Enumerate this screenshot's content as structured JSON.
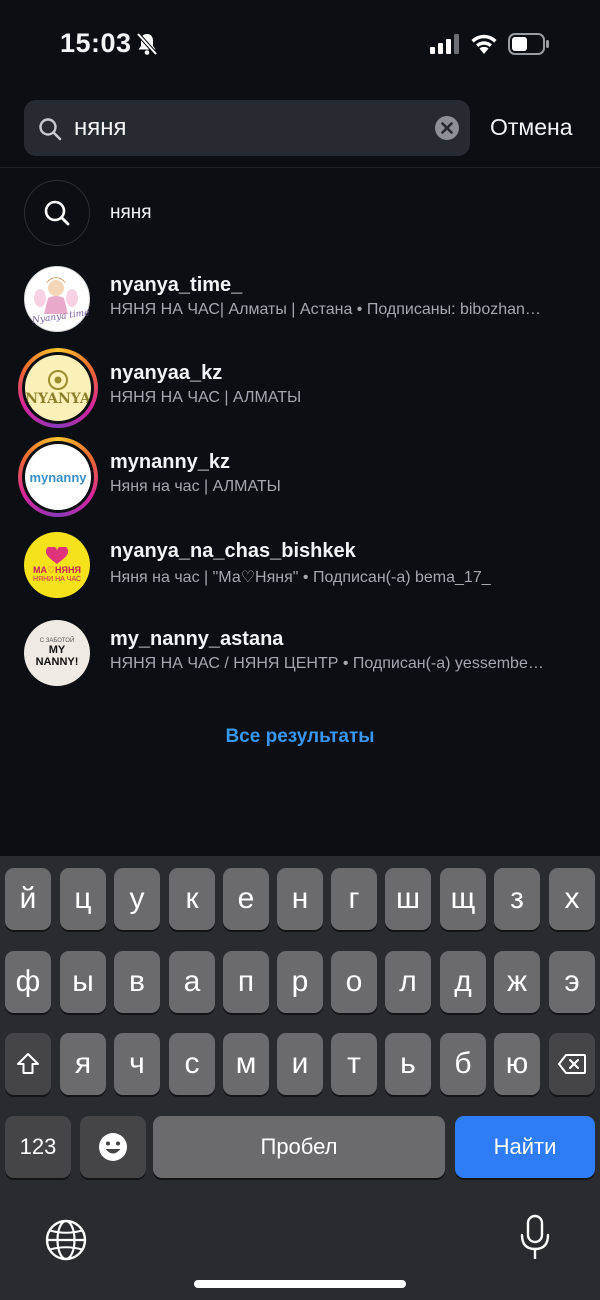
{
  "status_bar": {
    "time": "15:03",
    "icons": [
      "bell-slash-icon",
      "cellular-signal-icon",
      "wifi-icon",
      "battery-icon"
    ]
  },
  "search": {
    "query": "няня",
    "cancel_label": "Отмена"
  },
  "suggestion": {
    "text": "няня"
  },
  "results": [
    {
      "username": "nyanya_time_",
      "subtitle": "НЯНЯ НА ЧАС| Алматы | Астана • Подписаны: bibozhan…",
      "avatar_text": "Nyanya time",
      "has_story": false
    },
    {
      "username": "nyanyaa_kz",
      "subtitle": "НЯНЯ НА ЧАС | АЛМАТЫ",
      "avatar_text": "NYANYA",
      "has_story": true
    },
    {
      "username": "mynanny_kz",
      "subtitle": "Няня на час | АЛМАТЫ",
      "avatar_text": "mynanny",
      "has_story": true
    },
    {
      "username": "nyanya_na_chas_bishkek",
      "subtitle": "Няня на час | \"Ма♡Няня\" • Подписан(-а) bema_17_",
      "avatar_text": "МА♡НЯНЯ",
      "avatar_subtext": "НЯНИ НА ЧАС",
      "has_story": false
    },
    {
      "username": "my_nanny_astana",
      "subtitle": "НЯНЯ НА ЧАС /  НЯНЯ ЦЕНТР • Подписан(-а) yessembe…",
      "avatar_text": "MY NANNY!",
      "avatar_subtext": "С ЗАБОТОЙ",
      "has_story": false
    }
  ],
  "all_results_label": "Все результаты",
  "keyboard": {
    "row1": [
      "й",
      "ц",
      "у",
      "к",
      "е",
      "н",
      "г",
      "ш",
      "щ",
      "з",
      "х"
    ],
    "row2": [
      "ф",
      "ы",
      "в",
      "а",
      "п",
      "р",
      "о",
      "л",
      "д",
      "ж",
      "э"
    ],
    "row3": [
      "я",
      "ч",
      "с",
      "м",
      "и",
      "т",
      "ь",
      "б",
      "ю"
    ],
    "numbers_label": "123",
    "space_label": "Пробел",
    "go_label": "Найти"
  },
  "colors": {
    "background": "#0b0e13",
    "accent_link": "#3897f0",
    "go_key": "#2e7cf6"
  }
}
